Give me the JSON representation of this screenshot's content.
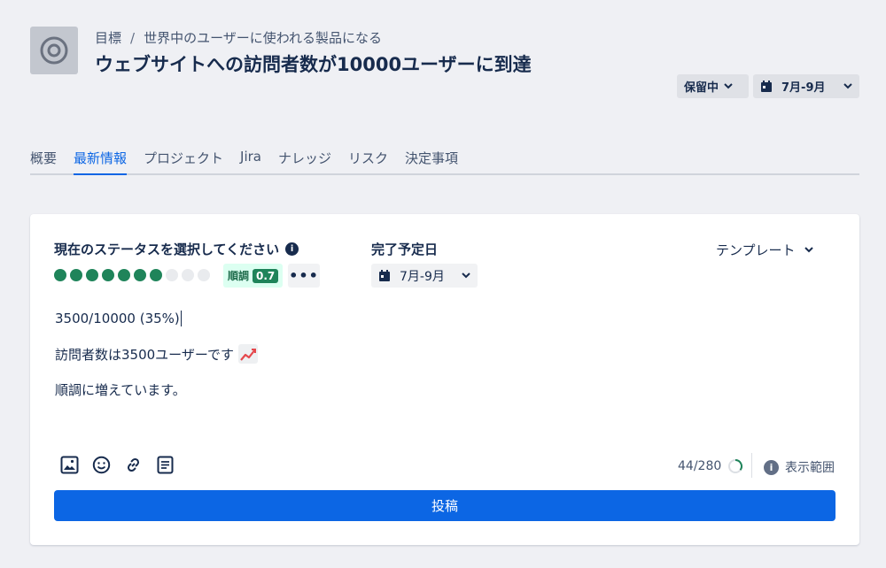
{
  "header": {
    "breadcrumb": [
      "目標",
      "世界中のユーザーに使われる製品になる"
    ],
    "breadcrumb_separator": "/",
    "title": "ウェブサイトへの訪問者数が10000ユーザーに到達",
    "status_pill": "保留中",
    "date_pill": "7月-9月"
  },
  "tabs": [
    {
      "label": "概要",
      "active": false
    },
    {
      "label": "最新情報",
      "active": true
    },
    {
      "label": "プロジェクト",
      "active": false
    },
    {
      "label": "Jira",
      "active": false
    },
    {
      "label": "ナレッジ",
      "active": false
    },
    {
      "label": "リスク",
      "active": false
    },
    {
      "label": "決定事項",
      "active": false
    }
  ],
  "update": {
    "status_label": "現在のステータスを選択してください",
    "progress_dots_filled": 7,
    "progress_dots_total": 10,
    "status_badge": "順調",
    "status_score": "0.7",
    "more_label": "•••",
    "due_label": "完了予定日",
    "due_value": "7月-9月",
    "template_label": "テンプレート",
    "lines": [
      "3500/10000 (35%)",
      "訪問者数は3500ユーザーです",
      "順調に増えています。"
    ],
    "emoji_icon": "chart-increasing-icon",
    "char_count": "44/280",
    "visibility_label": "表示範囲",
    "post_label": "投稿"
  },
  "colors": {
    "accent": "#0c66e4",
    "success": "#1f845a",
    "success_bg": "#dcfff1",
    "page_bg": "#eff0f4"
  },
  "icons": {
    "goal": "target-icon",
    "calendar": "calendar-icon",
    "chevron": "chevron-down-icon",
    "info": "info-icon",
    "toolbar": [
      "image-icon",
      "emoji-icon",
      "link-icon",
      "template-icon"
    ],
    "progress": "progress-ring-icon"
  }
}
